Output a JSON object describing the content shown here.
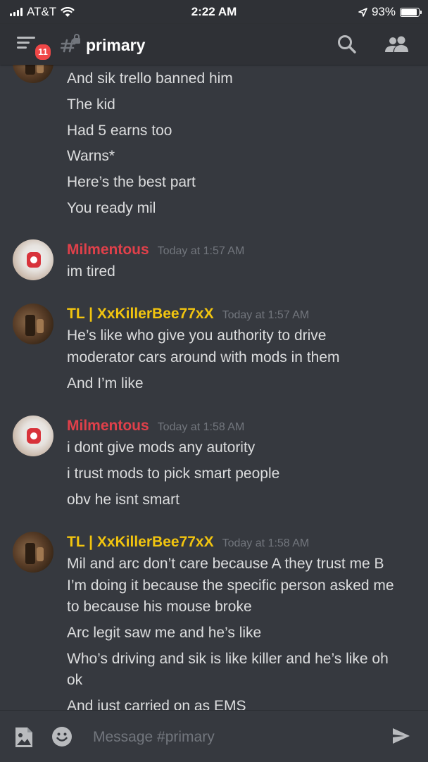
{
  "status_bar": {
    "carrier": "AT&T",
    "time": "2:22 AM",
    "battery": "93%",
    "battery_level": 0.93
  },
  "header": {
    "unread_count": "11",
    "channel_name": "primary"
  },
  "messages": [
    {
      "author": "",
      "timestamp": "",
      "lines": [
        "And sik trello banned him",
        "The kid",
        "Had 5 earns too",
        "Warns*",
        "Here’s the best part",
        "You ready mil"
      ]
    },
    {
      "author": "Milmentous",
      "timestamp": "Today at 1:57 AM",
      "lines": [
        "im tired"
      ]
    },
    {
      "author": "TL | XxKillerBee77xX",
      "timestamp": "Today at 1:57 AM",
      "lines": [
        "He’s like who give you authority to drive",
        "moderator cars around with mods in them",
        "And I’m like"
      ]
    },
    {
      "author": "Milmentous",
      "timestamp": "Today at 1:58 AM",
      "lines": [
        "i dont give mods any autority",
        "i trust mods to pick smart people",
        "obv he isnt smart"
      ]
    },
    {
      "author": "TL | XxKillerBee77xX",
      "timestamp": "Today at 1:58 AM",
      "lines": [
        "Mil and arc don’t care because A they trust me B",
        "I’m doing it because the specific person asked me",
        "to because his mouse broke",
        "Arc legit saw me and he’s like",
        "Who’s driving and sik is like killer and he’s like oh",
        "ok",
        "And just carried on as EMS"
      ]
    }
  ],
  "composer": {
    "placeholder": "Message #primary"
  },
  "icons": {
    "menu": "hamburger-menu-icon",
    "channel": "locked-text-channel-icon",
    "search": "search-icon",
    "members": "members-icon",
    "image": "image-upload-icon",
    "emoji": "emoji-icon",
    "send": "send-icon"
  },
  "colors": {
    "background": "#36393f",
    "header": "#2f3136",
    "killer_name": "#f1c40f",
    "mil_name": "#e0404a",
    "badge": "#f04747",
    "timestamp": "#72767d"
  }
}
